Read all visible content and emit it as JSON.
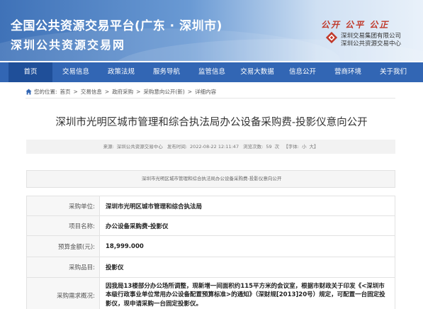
{
  "header": {
    "title_line1": "全国公共资源交易平台(广东 · 深圳市)",
    "title_line2": "深圳公共资源交易网",
    "slogan": "公开 公平 公正",
    "org_line1": "深圳交易集团有限公司",
    "org_line2": "深圳公共资源交易中心"
  },
  "nav": {
    "items": [
      {
        "label": "首页"
      },
      {
        "label": "交易信息"
      },
      {
        "label": "政策法规"
      },
      {
        "label": "服务导航"
      },
      {
        "label": "监管信息"
      },
      {
        "label": "交易大数据"
      },
      {
        "label": "信息公开"
      },
      {
        "label": "营商环境"
      },
      {
        "label": "关于我们"
      }
    ],
    "active_index": 0
  },
  "breadcrumb": {
    "prefix": "您的位置:",
    "items": [
      "首页",
      "交易信息",
      "政府采购",
      "采购意向公开(新)",
      "详细内容"
    ],
    "separator": ">"
  },
  "article": {
    "title": "深圳市光明区城市管理和综合执法局办公设备采购费-投影仪意向公开",
    "source_label": "来源:",
    "source": "深圳公共资源交易中心",
    "time_label": "发布时间:",
    "time": "2022-08-22 12:11:47",
    "views_label": "浏览次数:",
    "views": "59",
    "views_unit": "次",
    "font_label": "【字体:",
    "font_size": "小",
    "font_size2": "大】",
    "notice": "深圳市光明区城市管理和综合执法局办公设备采购费-投影仪意向公开"
  },
  "table": {
    "rows": [
      {
        "label": "采购单位:",
        "value": "深圳市光明区城市管理和综合执法局"
      },
      {
        "label": "项目名称:",
        "value": "办公设备采购费-投影仪"
      },
      {
        "label": "预算金额(元):",
        "value": "18,999.000"
      },
      {
        "label": "采购品目:",
        "value": "投影仪"
      },
      {
        "label": "采购需求概况:",
        "value": "因我局13楼部分办公场所调整，现新增一间面积约115平方米的会议室，根据市财政关于印发《<深圳市本级行政事业单位常用办公设备配置预算标准>的通知》（深财规[2013]20号）规定，可配置一台固定投影仪，现申请采购一台固定投影仪。"
      }
    ]
  },
  "colors": {
    "nav_bg": "#3266b4",
    "nav_active": "#1f4f99",
    "slogan": "#c0392b"
  }
}
